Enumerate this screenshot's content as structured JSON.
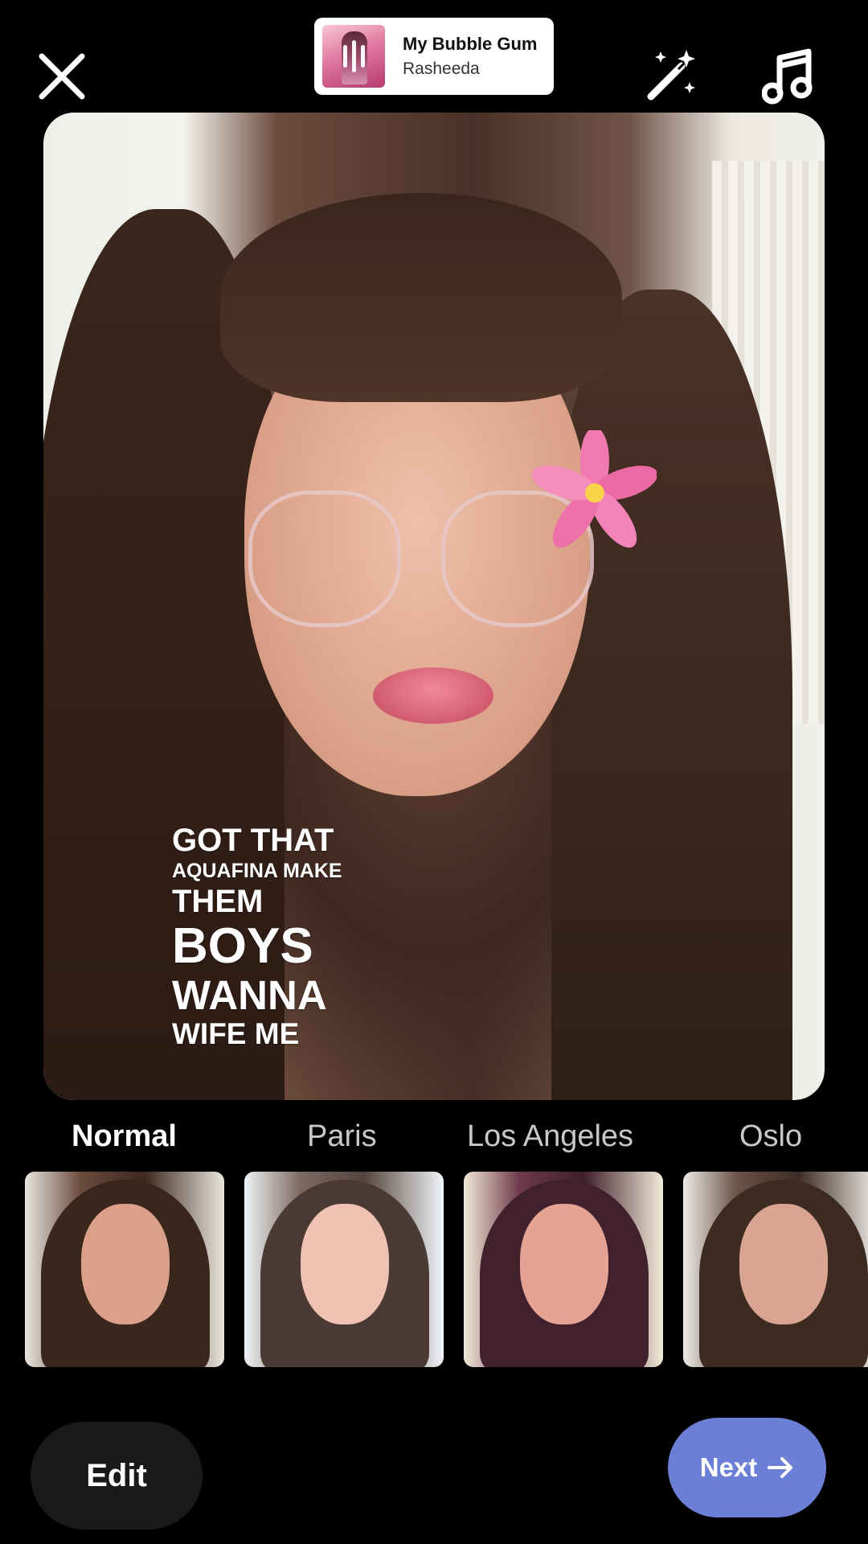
{
  "top_bar": {
    "close_icon": "close-icon",
    "wand_icon": "magic-wand-icon",
    "music_icon": "music-note-icon"
  },
  "music": {
    "title": "My Bubble Gum",
    "artist": "Rasheeda"
  },
  "lyrics": {
    "line1": "GOT THAT",
    "line2": "AQUAFINA MAKE",
    "line3": "THEM",
    "line4": "BOYS",
    "line5": "WANNA",
    "line6": "WIFE ME"
  },
  "filters": {
    "items": [
      {
        "label": "Normal",
        "active": true
      },
      {
        "label": "Paris",
        "active": false
      },
      {
        "label": "Los Angeles",
        "active": false
      },
      {
        "label": "Oslo",
        "active": false
      }
    ]
  },
  "actions": {
    "edit_label": "Edit",
    "next_label": "Next",
    "next_icon": "arrow-right-icon",
    "next_color": "#6b7fd6"
  }
}
